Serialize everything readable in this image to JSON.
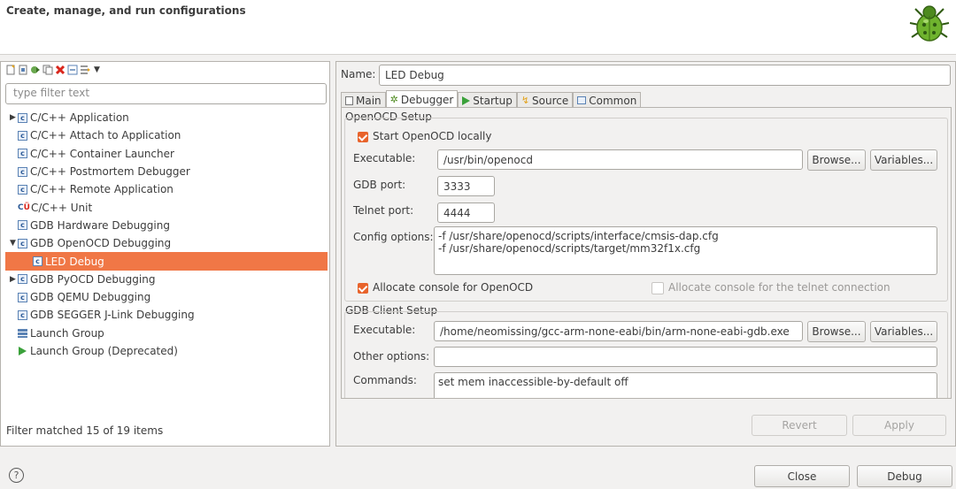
{
  "header": {
    "title": "Create, manage, and run configurations"
  },
  "left": {
    "filter_placeholder": "type filter text",
    "tree": [
      {
        "label": "C/C++ Application",
        "icon": "c-config-icon",
        "expander": "right"
      },
      {
        "label": "C/C++ Attach to Application",
        "icon": "c-config-icon",
        "expander": ""
      },
      {
        "label": "C/C++ Container Launcher",
        "icon": "c-config-icon",
        "expander": ""
      },
      {
        "label": "C/C++ Postmortem Debugger",
        "icon": "c-config-icon",
        "expander": ""
      },
      {
        "label": "C/C++ Remote Application",
        "icon": "c-config-icon",
        "expander": ""
      },
      {
        "label": "C/C++ Unit",
        "icon": "cu-unit-icon",
        "expander": ""
      },
      {
        "label": "GDB Hardware Debugging",
        "icon": "c-config-icon",
        "expander": ""
      },
      {
        "label": "GDB OpenOCD Debugging",
        "icon": "c-config-icon",
        "expander": "down"
      },
      {
        "label": "LED Debug",
        "icon": "c-config-icon",
        "expander": "",
        "child": true,
        "selected": true
      },
      {
        "label": "GDB PyOCD Debugging",
        "icon": "c-config-icon",
        "expander": "right"
      },
      {
        "label": "GDB QEMU Debugging",
        "icon": "c-config-icon",
        "expander": ""
      },
      {
        "label": "GDB SEGGER J-Link Debugging",
        "icon": "c-config-icon",
        "expander": ""
      },
      {
        "label": "Launch Group",
        "icon": "launch-group-icon",
        "expander": ""
      },
      {
        "label": "Launch Group (Deprecated)",
        "icon": "play-icon",
        "expander": ""
      }
    ],
    "status": "Filter matched 15 of 19 items"
  },
  "right": {
    "name_label": "Name:",
    "name_value": "LED Debug",
    "tabs": [
      {
        "label": "Main",
        "icon": "document-icon",
        "active": false
      },
      {
        "label": "Debugger",
        "icon": "bug-icon",
        "active": true
      },
      {
        "label": "Startup",
        "icon": "play-icon",
        "active": false
      },
      {
        "label": "Source",
        "icon": "source-icon",
        "active": false
      },
      {
        "label": "Common",
        "icon": "common-icon",
        "active": false
      }
    ],
    "openocd": {
      "title": "OpenOCD Setup",
      "start_locally": "Start OpenOCD locally",
      "executable_label": "Executable:",
      "executable_value": "/usr/bin/openocd",
      "browse": "Browse...",
      "variables": "Variables...",
      "gdb_port_label": "GDB port:",
      "gdb_port_value": "3333",
      "telnet_port_label": "Telnet port:",
      "telnet_port_value": "4444",
      "config_label": "Config options:",
      "config_value": "-f /usr/share/openocd/scripts/interface/cmsis-dap.cfg\n-f /usr/share/openocd/scripts/target/mm32f1x.cfg",
      "allocate_console": "Allocate console for OpenOCD",
      "allocate_telnet": "Allocate console for the telnet connection"
    },
    "gdb": {
      "title": "GDB Client Setup",
      "executable_label": "Executable:",
      "executable_value": "/home/neomissing/gcc-arm-none-eabi/bin/arm-none-eabi-gdb.exe",
      "browse": "Browse...",
      "variables": "Variables...",
      "other_label": "Other options:",
      "other_value": "",
      "commands_label": "Commands:",
      "commands_value": "set mem inaccessible-by-default off"
    },
    "revert": "Revert",
    "apply": "Apply"
  },
  "footer": {
    "help": "?",
    "close": "Close",
    "debug": "Debug"
  }
}
